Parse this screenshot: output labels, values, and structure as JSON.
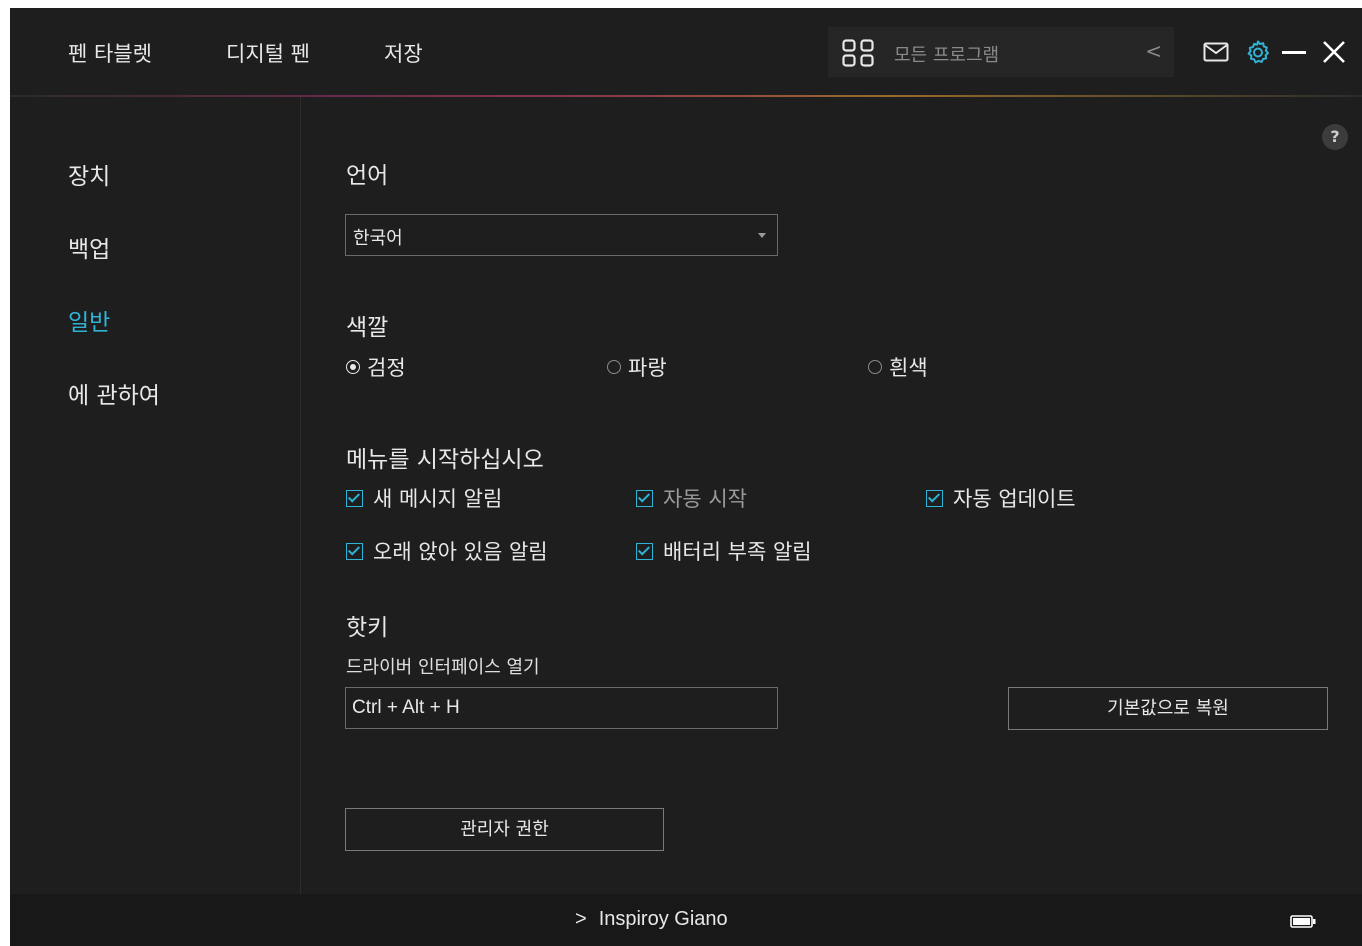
{
  "topnav": {
    "items": [
      {
        "label": "펜 타블렛"
      },
      {
        "label": "디지털 펜"
      },
      {
        "label": "저장"
      }
    ],
    "program_select": {
      "placeholder": "모든 프로그램",
      "chevron": "<"
    },
    "icons": [
      "grid-icon",
      "mail-icon",
      "gear-icon",
      "minimize-icon",
      "close-icon"
    ],
    "accent_color": "#2fb3d6"
  },
  "sidebar": {
    "items": [
      {
        "label": "장치"
      },
      {
        "label": "백업"
      },
      {
        "label": "일반",
        "active": true
      },
      {
        "label": "에 관하여"
      }
    ]
  },
  "main": {
    "help": "?",
    "language": {
      "title": "언어",
      "selected": "한국어"
    },
    "color": {
      "title": "색깔",
      "options": [
        {
          "label": "검정",
          "selected": true
        },
        {
          "label": "파랑",
          "selected": false
        },
        {
          "label": "흰색",
          "selected": false
        }
      ]
    },
    "startup": {
      "title": "메뉴를 시작하십시오",
      "options": [
        {
          "label": "새 메시지 알림",
          "checked": true
        },
        {
          "label": "자동 시작",
          "checked": true
        },
        {
          "label": "자동 업데이트",
          "checked": true
        },
        {
          "label": "오래 앉아 있음 알림",
          "checked": true
        },
        {
          "label": "배터리 부족 알림",
          "checked": true
        }
      ]
    },
    "hotkey": {
      "title": "핫키",
      "label": "드라이버 인터페이스  열기",
      "value": "Ctrl + Alt + H",
      "restore_button": "기본값으로 복원"
    },
    "admin_button": "관리자 권한"
  },
  "bottombar": {
    "device_name": "Inspiroy Giano",
    "chevron": ">"
  }
}
